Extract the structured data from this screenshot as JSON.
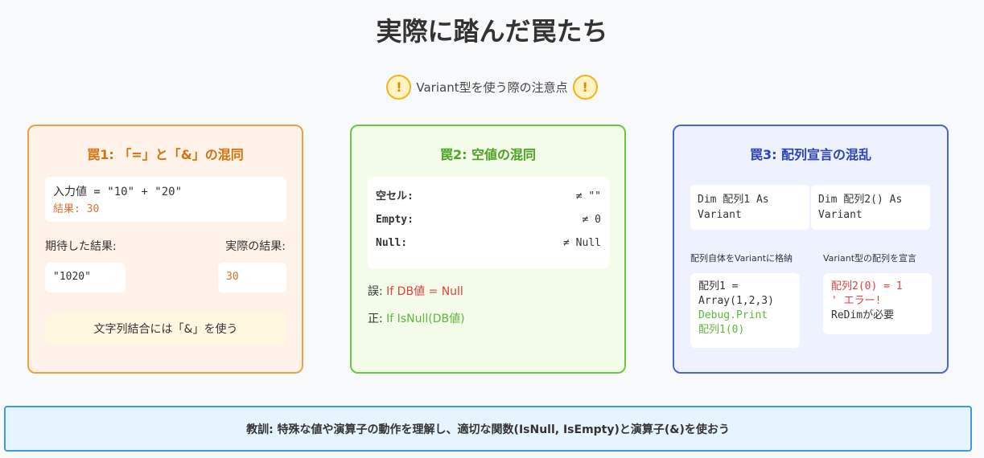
{
  "title": "実際に踏んだ罠たち",
  "subtitle": "Variant型を使う際の注意点",
  "warn_glyph": "!",
  "trap1": {
    "title": "罠1: 「=」と「&」の混同",
    "code_line1": "入力値 = \"10\" + \"20\"",
    "code_line2": "結果: 30",
    "expected_label": "期待した結果:",
    "actual_label": "実際の結果:",
    "expected_value": "\"1020\"",
    "actual_value": "30",
    "tip": "文字列結合には「&」を使う"
  },
  "trap2": {
    "title": "罠2: 空値の混同",
    "rows": [
      {
        "key": "空セル:",
        "value": "≠ \"\""
      },
      {
        "key": "Empty:",
        "value": "≠ 0"
      },
      {
        "key": "Null:",
        "value": "≠ Null"
      }
    ],
    "wrong_prefix": "誤: ",
    "wrong_code": "If DB値 = Null",
    "right_prefix": "正: ",
    "right_code": "If IsNull(DB値)"
  },
  "trap3": {
    "title": "罠3: 配列宣言の混乱",
    "dim1": "Dim 配列1 As Variant",
    "dim2": "Dim 配列2() As Variant",
    "label1": "配列自体をVariantに格納",
    "label2": "Variant型の配列を宣言",
    "code1_line1": "配列1 =",
    "code1_line2": "Array(1,2,3)",
    "code1_line3": "Debug.Print",
    "code1_line4": "配列1(0)",
    "code2_line1": "配列2(0) = 1",
    "code2_line2": "' エラー!",
    "code2_line3": "ReDimが必要"
  },
  "lesson": "教訓: 特殊な値や演算子の動作を理解し、適切な関数(IsNull, IsEmpty)と演算子(&)を使おう",
  "colors": {
    "trap1_accent": "#f0a040",
    "trap2_accent": "#6cc63e",
    "trap3_accent": "#4a66d6",
    "error": "#e04040",
    "lesson_border": "#3a9be0"
  }
}
